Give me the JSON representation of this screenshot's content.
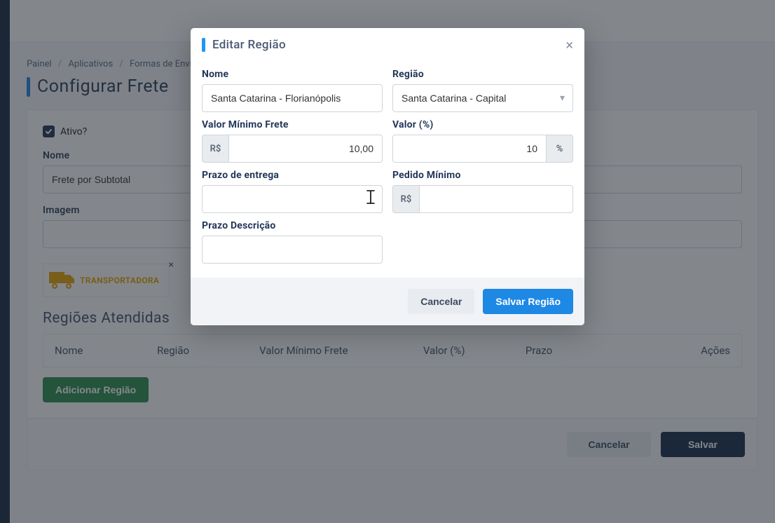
{
  "breadcrumb": {
    "item1": "Painel",
    "item2": "Aplicativos",
    "item3": "Formas de Envio",
    "sep": "/"
  },
  "page": {
    "title": "Configurar Frete",
    "active_label": "Ativo?",
    "name_label": "Nome",
    "name_value": "Frete por Subtotal",
    "image_label": "Imagem",
    "thumb_label": "TRANSPORTADORA",
    "regions_heading": "Regiões Atendidas",
    "table": {
      "nome": "Nome",
      "regiao": "Região",
      "minfrete": "Valor Mínimo Frete",
      "valorpct": "Valor (%)",
      "prazo": "Prazo",
      "acoes": "Ações"
    },
    "add_region": "Adicionar Região",
    "cancel": "Cancelar",
    "save": "Salvar"
  },
  "modal": {
    "title": "Editar Região",
    "labels": {
      "nome": "Nome",
      "regiao": "Região",
      "min_frete": "Valor Mínimo Frete",
      "valor_pct": "Valor (%)",
      "prazo_entrega": "Prazo de entrega",
      "pedido_min": "Pedido Mínimo",
      "prazo_descricao": "Prazo Descrição"
    },
    "addons": {
      "rs": "R$",
      "pct": "%"
    },
    "values": {
      "nome": "Santa Catarina - Florianópolis",
      "regiao": "Santa Catarina - Capital",
      "min_frete": "10,00",
      "valor_pct": "10",
      "prazo_entrega": "",
      "pedido_min": "",
      "prazo_descricao": ""
    },
    "buttons": {
      "cancel": "Cancelar",
      "save": "Salvar Região"
    }
  }
}
